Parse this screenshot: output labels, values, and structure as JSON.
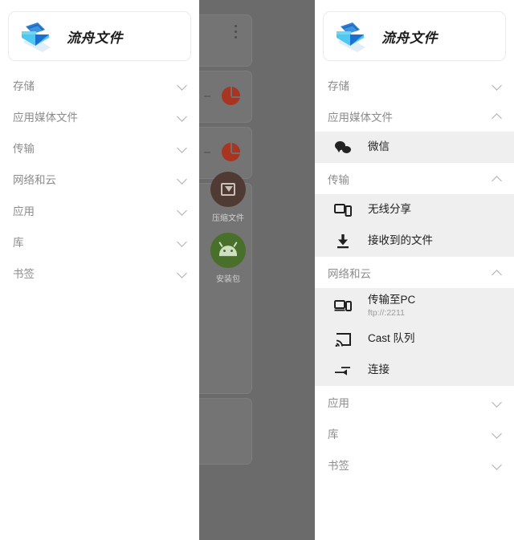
{
  "app": {
    "brand_name": "流舟文件",
    "logo_icon": "boat-folder-logo",
    "accent_blue": "#29b6f0",
    "accent_deep_blue": "#1565c0"
  },
  "left_drawer": {
    "sections": [
      {
        "label": "存储",
        "state": "collapsed",
        "chevron": "chevron-down-icon"
      },
      {
        "label": "应用媒体文件",
        "state": "collapsed",
        "chevron": "chevron-down-icon"
      },
      {
        "label": "传输",
        "state": "collapsed",
        "chevron": "chevron-down-icon"
      },
      {
        "label": "网络和云",
        "state": "collapsed",
        "chevron": "chevron-down-icon"
      },
      {
        "label": "应用",
        "state": "collapsed",
        "chevron": "chevron-down-icon"
      },
      {
        "label": "库",
        "state": "collapsed",
        "chevron": "chevron-down-icon"
      },
      {
        "label": "书签",
        "state": "collapsed",
        "chevron": "chevron-down-icon"
      }
    ]
  },
  "right_drawer": {
    "sections": [
      {
        "label": "存储",
        "state": "collapsed",
        "chevron": "chevron-down-icon",
        "items": []
      },
      {
        "label": "应用媒体文件",
        "state": "expanded",
        "chevron": "chevron-up-icon",
        "items": [
          {
            "title": "微信",
            "subtitle": "",
            "icon": "wechat-icon"
          }
        ]
      },
      {
        "label": "传输",
        "state": "expanded",
        "chevron": "chevron-up-icon",
        "items": [
          {
            "title": "无线分享",
            "subtitle": "",
            "icon": "phonelink-icon"
          },
          {
            "title": "接收到的文件",
            "subtitle": "",
            "icon": "download-icon"
          }
        ]
      },
      {
        "label": "网络和云",
        "state": "expanded",
        "chevron": "chevron-up-icon",
        "items": [
          {
            "title": "传输至PC",
            "subtitle": "ftp://:2211",
            "icon": "computer-icon"
          },
          {
            "title": "Cast 队列",
            "subtitle": "",
            "icon": "cast-icon"
          },
          {
            "title": "连接",
            "subtitle": "",
            "icon": "connect-arrow-icon"
          }
        ]
      },
      {
        "label": "应用",
        "state": "collapsed",
        "chevron": "chevron-down-icon",
        "items": []
      },
      {
        "label": "库",
        "state": "collapsed",
        "chevron": "chevron-down-icon",
        "items": []
      },
      {
        "label": "书签",
        "state": "collapsed",
        "chevron": "chevron-down-icon",
        "items": []
      }
    ]
  },
  "background": {
    "overflow_icon": "more-vert-icon",
    "storage_pie_icon": "pie-chart-icon",
    "tiles": [
      {
        "label": "压缩文件",
        "icon": "archive-icon",
        "color": "#4f3b34"
      },
      {
        "label": "安装包",
        "icon": "android-icon",
        "color": "#49702a"
      }
    ]
  }
}
